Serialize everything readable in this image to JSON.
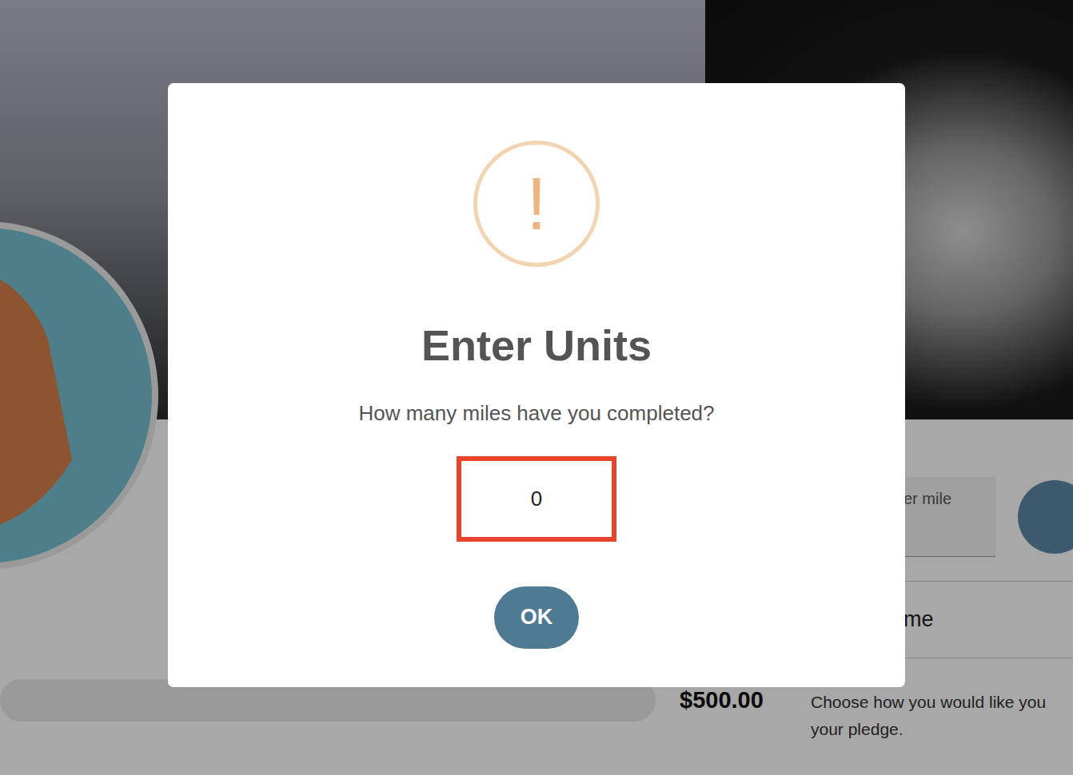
{
  "page": {
    "field_label": "er mile",
    "name_label": "me",
    "amount": "$500.00",
    "pledge_text": [
      "Choose how you would like you",
      "your pledge."
    ],
    "progress": {
      "level": 0
    }
  },
  "modal": {
    "icon": "!",
    "title": "Enter Units",
    "prompt": "How many miles have you completed?",
    "input": {
      "value": "0",
      "focused": true
    },
    "buttons": [
      "OK"
    ]
  }
}
